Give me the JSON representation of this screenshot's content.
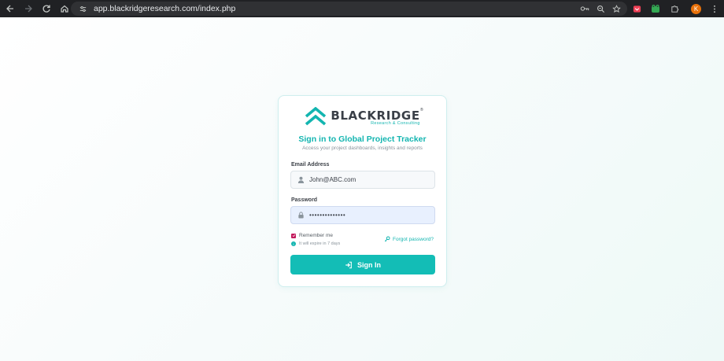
{
  "browser": {
    "url": "app.blackridgeresearch.com/index.php",
    "profile_initial": "K"
  },
  "brand": {
    "name": "BLACKRIDGE",
    "tagline": "Research & Consulting",
    "reg_mark": "®",
    "accent_color": "#13b5b0"
  },
  "login": {
    "title": "Sign in to Global Project Tracker",
    "subtitle": "Access your project dashboards, insights and reports",
    "email_label": "Email Address",
    "email_value": "John@ABC.com",
    "password_label": "Password",
    "password_value": "••••••••••••••",
    "remember_label": "Remember me",
    "remember_checked": true,
    "expire_note": "It will expire in 7 days",
    "forgot_label": "Forgot password?",
    "signin_label": "Sign In"
  }
}
